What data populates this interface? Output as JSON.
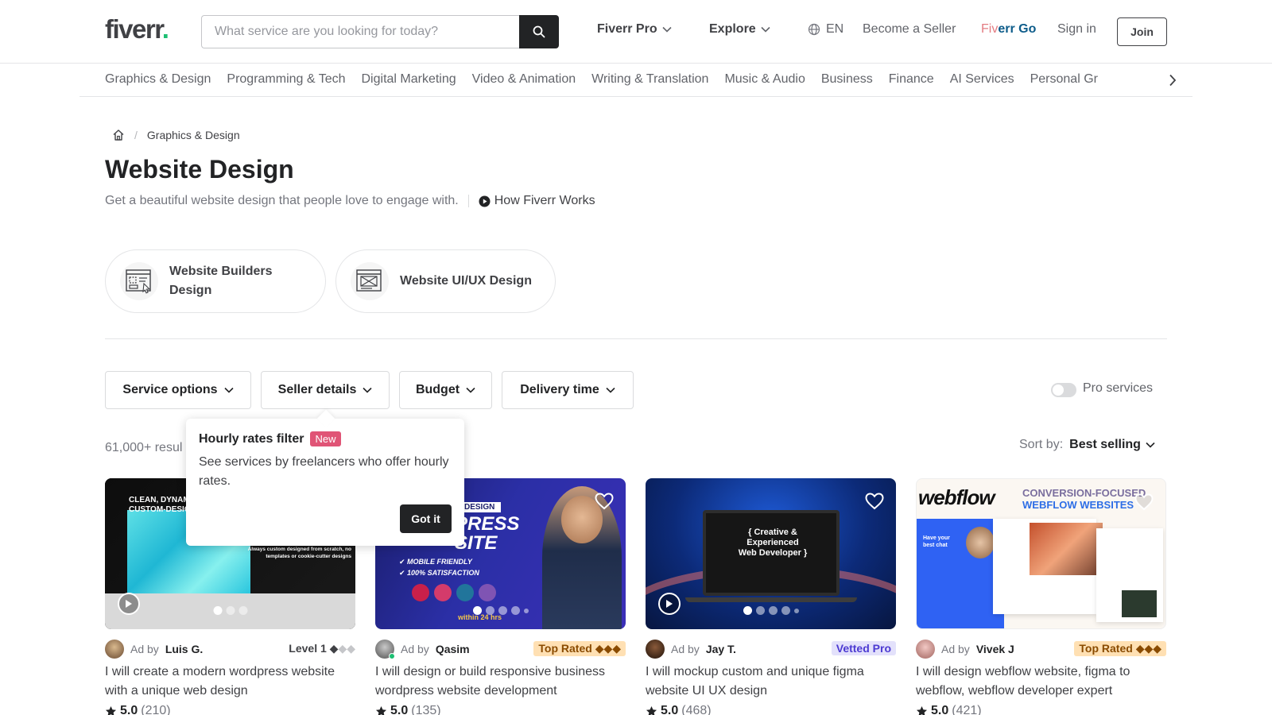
{
  "header": {
    "logo": "fiverr",
    "logo_dot": ".",
    "search_placeholder": "What service are you looking for today?",
    "fiverr_pro": "Fiverr Pro",
    "explore": "Explore",
    "language": "EN",
    "become_seller": "Become a Seller",
    "fiverr_go_a": "Fiv",
    "fiverr_go_b": "err Go",
    "sign_in": "Sign in",
    "join": "Join"
  },
  "categories": [
    "Graphics & Design",
    "Programming & Tech",
    "Digital Marketing",
    "Video & Animation",
    "Writing & Translation",
    "Music & Audio",
    "Business",
    "Finance",
    "AI Services",
    "Personal Gr"
  ],
  "breadcrumb": {
    "current": "Graphics & Design",
    "separator": "/"
  },
  "page": {
    "title": "Website Design",
    "subtitle": "Get a beautiful website design that people love to engage with.",
    "how_link": "How Fiverr Works"
  },
  "subcategories": [
    {
      "line1": "Website Builders",
      "line2": "Design"
    },
    {
      "line1": "Website UI/UX Design",
      "line2": ""
    }
  ],
  "filters": [
    "Service options",
    "Seller details",
    "Budget",
    "Delivery time"
  ],
  "pro_services": "Pro services",
  "results": "61,000+ resul",
  "sort": {
    "label": "Sort by:",
    "value": "Best selling"
  },
  "tooltip": {
    "title": "Hourly rates filter",
    "badge": "New",
    "body": "See services by freelancers who offer hourly rates.",
    "button": "Got it"
  },
  "gigs": [
    {
      "ad_by": "Ad by",
      "seller": "Luis G.",
      "badge": "Level 1",
      "badge_suffix": "◆",
      "badge_dim": "◆◆",
      "title": "I will create a modern wordpress website with a unique web design",
      "score": "5.0",
      "count": "(210)",
      "thumb_text_1": "CLEAN, DYNAMIC",
      "thumb_text_2": "CUSTOM-DESIGN",
      "thumb_text_3": "Always custom designed from scratch, no templates or cookie-cutter designs"
    },
    {
      "ad_by": "Ad by",
      "seller": "Qasim",
      "badge": "Top Rated ◆◆◆",
      "title": "I will design or build responsive business wordpress website development",
      "score": "5.0",
      "count": "(135)",
      "thumb_text_1": "DESIGN",
      "thumb_text_2": "PRESS",
      "thumb_text_3": "SITE",
      "thumb_text_4": "MOBILE FRIENDLY",
      "thumb_text_5": "100% SATISFACTION",
      "thumb_text_6": "within 24 hrs"
    },
    {
      "ad_by": "Ad by",
      "seller": "Jay T.",
      "badge": "Vetted Pro",
      "title": "I will mockup custom and unique figma website UI UX design",
      "score": "5.0",
      "count": "(468)",
      "thumb_text_1": "{ Creative &",
      "thumb_text_2": "Experienced",
      "thumb_text_3": "Web Developer }"
    },
    {
      "ad_by": "Ad by",
      "seller": "Vivek J",
      "badge": "Top Rated ◆◆◆",
      "title": "I will design webflow website, figma to webflow, webflow developer expert",
      "score": "5.0",
      "count": "(421)",
      "thumb_text_1": "webflow",
      "thumb_text_2": "CONVERSION-FOCUSED",
      "thumb_text_3": "WEBFLOW WEBSITES",
      "thumb_text_4": "Have your best chat"
    }
  ],
  "colors": {
    "brand_green": "#1dbf73",
    "dark": "#222325",
    "new_badge": "#e05476"
  }
}
